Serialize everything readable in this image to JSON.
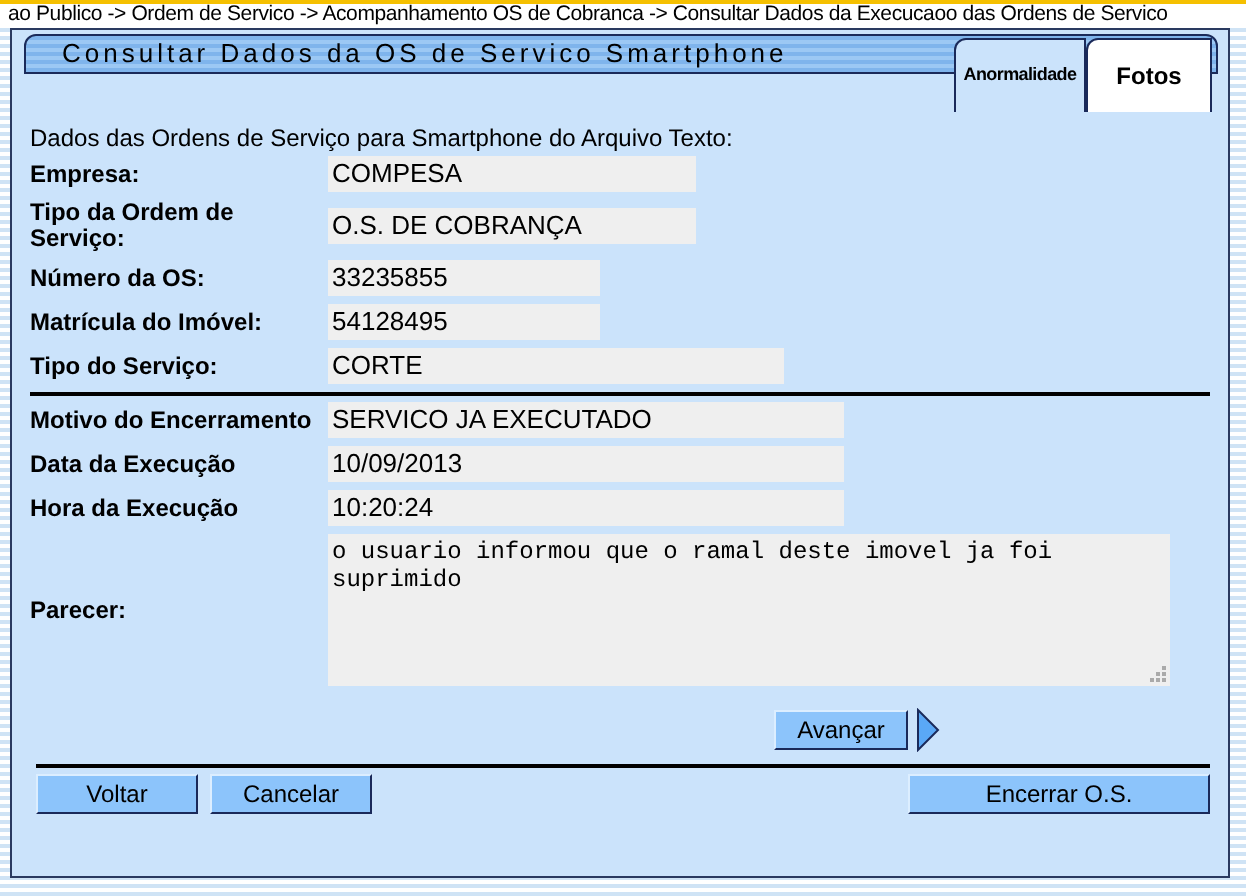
{
  "breadcrumb": "ao Publico -> Ordem de Servico -> Acompanhamento OS de Cobranca -> Consultar Dados da Execucaoo das Ordens de Servico",
  "title": "Consultar Dados da OS de Servico Smartphone",
  "tabs": [
    {
      "label": "Anormalidade",
      "selected": false
    },
    {
      "label": "Fotos",
      "selected": true
    }
  ],
  "intro": "Dados das Ordens de Serviço para Smartphone do Arquivo Texto:",
  "fields": [
    {
      "label": "Empresa:",
      "value": "COMPESA"
    },
    {
      "label": "Tipo da Ordem de Serviço:",
      "value": "O.S. DE COBRANÇA"
    },
    {
      "label": "Número da OS:",
      "value": "33235855"
    },
    {
      "label": "Matrícula do Imóvel:",
      "value": "54128495"
    },
    {
      "label": "Tipo do Serviço:",
      "value": "CORTE"
    }
  ],
  "execution_fields": [
    {
      "label": "Motivo do Encerramento",
      "value": "SERVICO JA EXECUTADO",
      "kind": "line"
    },
    {
      "label": "Data da Execução",
      "value": "10/09/2013",
      "kind": "line"
    },
    {
      "label": "Hora da Execução",
      "value": "10:20:24",
      "kind": "line"
    },
    {
      "label": "Parecer:",
      "value": "o usuario informou que o ramal deste imovel ja foi suprimido",
      "kind": "area"
    }
  ],
  "next_button": "Avançar",
  "left_buttons": [
    "Voltar",
    "Cancelar"
  ],
  "right_button": "Encerrar O.S."
}
